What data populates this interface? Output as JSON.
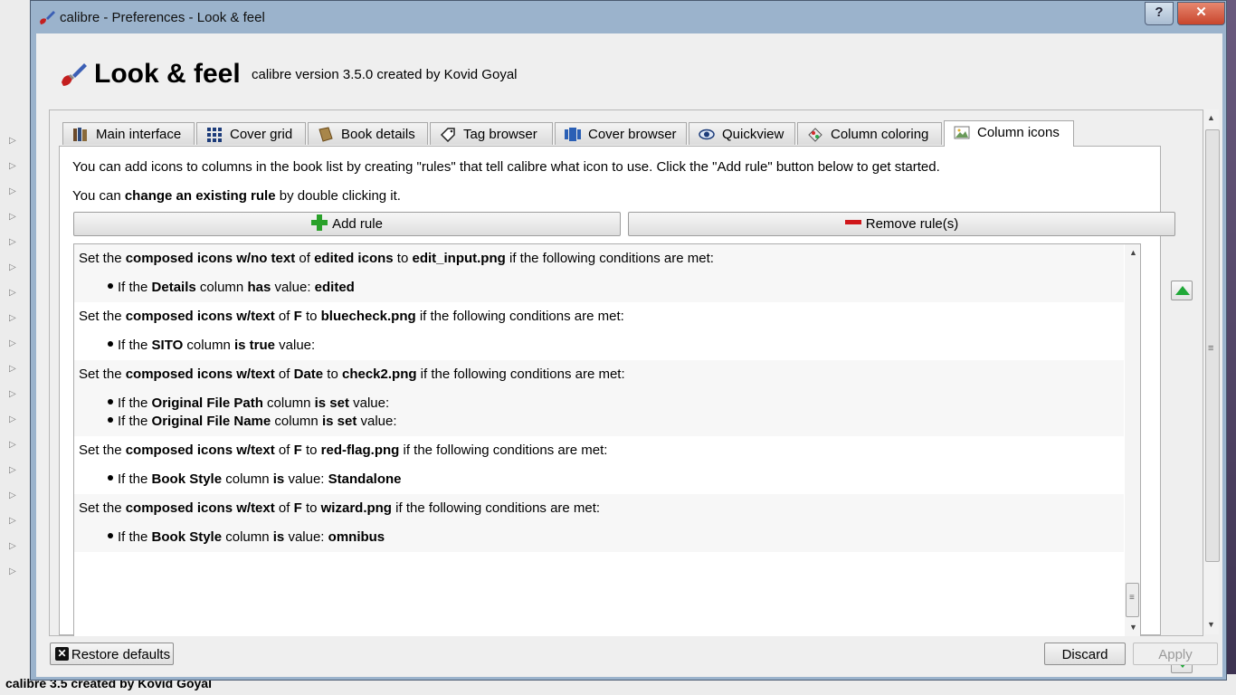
{
  "window": {
    "title": "calibre - Preferences - Look & feel",
    "help_label": "?",
    "close_label": "✕"
  },
  "header": {
    "title": "Look & feel",
    "version": "calibre version 3.5.0 created by Kovid Goyal"
  },
  "tabs": [
    {
      "label": "Main interface",
      "icon": "books-icon"
    },
    {
      "label": "Cover grid",
      "icon": "grid-icon"
    },
    {
      "label": "Book details",
      "icon": "book-icon"
    },
    {
      "label": "Tag browser",
      "icon": "tag-icon"
    },
    {
      "label": "Cover browser",
      "icon": "cover-flow-icon"
    },
    {
      "label": "Quickview",
      "icon": "eye-icon"
    },
    {
      "label": "Column coloring",
      "icon": "palette-icon"
    },
    {
      "label": "Column icons",
      "icon": "image-icon",
      "active": true
    }
  ],
  "column_icons": {
    "intro": "You can add icons to columns in the book list by creating \"rules\" that tell calibre what icon to use. Click the \"Add rule\" button below to get started.",
    "hint_prefix": "You can ",
    "hint_bold": "change an existing rule",
    "hint_suffix": " by double clicking it.",
    "add_rule_label": "Add rule",
    "remove_rule_label": "Remove rule(s)"
  },
  "rules": [
    {
      "kind": "composed icons w/no text",
      "column": "edited icons",
      "icon": "edit_input.png",
      "conditions": [
        {
          "column": "Details",
          "op": "has",
          "value": "edited"
        }
      ]
    },
    {
      "kind": "composed icons w/text",
      "column": "F",
      "icon": "bluecheck.png",
      "conditions": [
        {
          "column": "SITO",
          "op": "is true",
          "value": ""
        }
      ]
    },
    {
      "kind": "composed icons w/text",
      "column": "Date",
      "icon": "check2.png",
      "conditions": [
        {
          "column": "Original File Path",
          "op": "is set",
          "value": ""
        },
        {
          "column": "Original File Name",
          "op": "is set",
          "value": ""
        }
      ]
    },
    {
      "kind": "composed icons w/text",
      "column": "F",
      "icon": "red-flag.png",
      "conditions": [
        {
          "column": "Book Style",
          "op": "is",
          "value": "Standalone"
        }
      ]
    },
    {
      "kind": "composed icons w/text",
      "column": "F",
      "icon": "wizard.png",
      "conditions": [
        {
          "column": "Book Style",
          "op": "is",
          "value": "omnibus"
        }
      ]
    }
  ],
  "rule_text": {
    "set_the": "Set the ",
    "of": " of ",
    "to": " to ",
    "suffix": " if the following conditions are met:",
    "if_the": "If the ",
    "column_word": " column ",
    "value_word": " value:"
  },
  "footer": {
    "restore_label": "Restore defaults",
    "discard_label": "Discard",
    "apply_label": "Apply"
  },
  "background": {
    "status_text": "calibre 3.5 created by Kovid Goyal"
  },
  "colors": {
    "accent_green": "#20a838",
    "remove_red": "#d0161a",
    "titlebar": "#9bb3cc"
  }
}
